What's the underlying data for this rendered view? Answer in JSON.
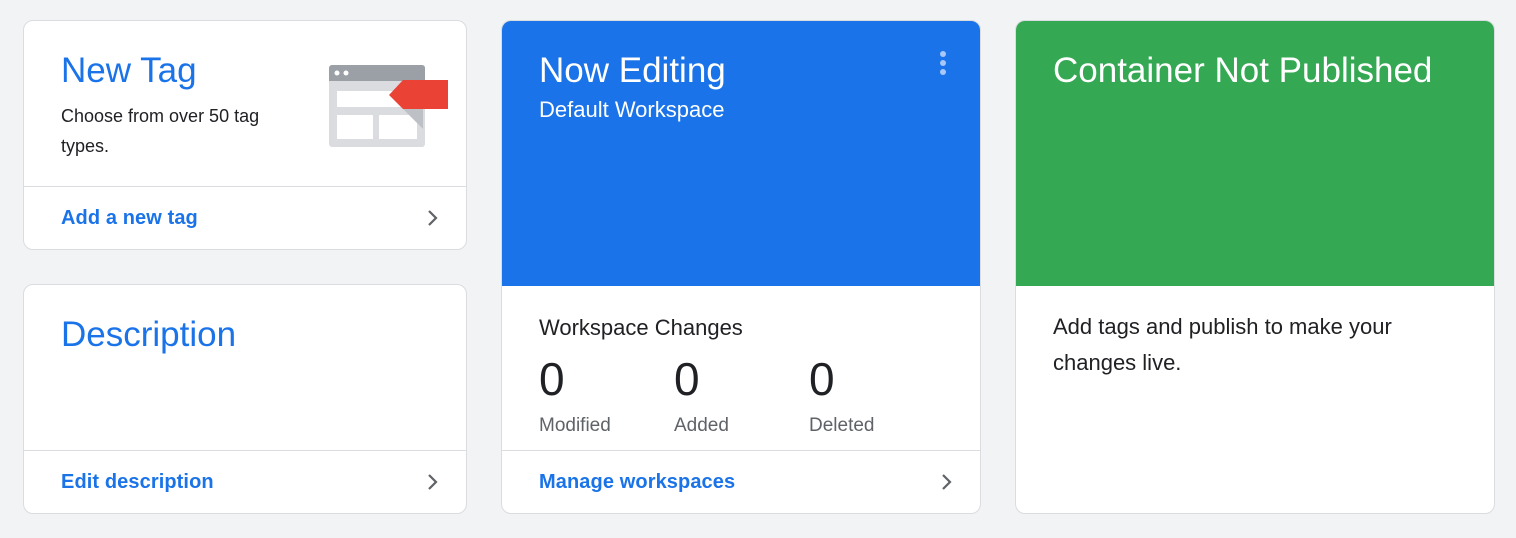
{
  "new_tag_card": {
    "title": "New Tag",
    "description": "Choose from over 50 tag types.",
    "link_label": "Add a new tag",
    "illustration_icon": "tag-types-illustration-icon"
  },
  "description_card": {
    "title": "Description",
    "link_label": "Edit description"
  },
  "workspace_card": {
    "title": "Now Editing",
    "workspace_name": "Default Workspace",
    "menu_icon": "more-vert-icon",
    "changes_title": "Workspace Changes",
    "stats": [
      {
        "value": "0",
        "label": "Modified"
      },
      {
        "value": "0",
        "label": "Added"
      },
      {
        "value": "0",
        "label": "Deleted"
      }
    ],
    "link_label": "Manage workspaces"
  },
  "publish_card": {
    "title": "Container Not Published",
    "description": "Add tags and publish to make your changes live."
  },
  "colors": {
    "background": "#f1f3f4",
    "link_blue": "#1a73e8",
    "workspace_blue": "#1a73e8",
    "publish_green": "#34a853",
    "tag_red": "#ea4335"
  }
}
